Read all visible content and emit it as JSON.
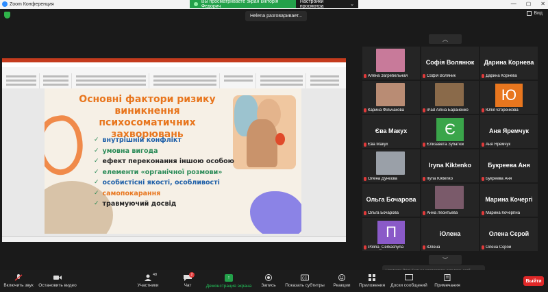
{
  "window": {
    "title": "Zoom Конференция",
    "controls": [
      "—",
      "▢",
      "✕"
    ]
  },
  "share_banner": {
    "text": "Вы просматриваете экран Вікторія Федорич",
    "options_label": "Настройки просмотра"
  },
  "view_button": {
    "label": "Вид"
  },
  "speaking_indicator": {
    "text": "Helena разговаривает..."
  },
  "slide": {
    "title": "Основні фактори ризику виникнення психосоматичних захворювань",
    "bullets": [
      {
        "text": "внутрішній конфлікт",
        "color": "#1e5fa8"
      },
      {
        "text": "умовна вигода",
        "color": "#2a8a57"
      },
      {
        "text": "ефект переконання іншою особою",
        "color": "#222222"
      },
      {
        "text": "елементи «органічної розмови»",
        "color": "#2a8a57"
      },
      {
        "text": "особистісні якості, особливості",
        "color": "#1e5fa8"
      },
      {
        "text": "самопокарання",
        "color": "#e8761e"
      },
      {
        "text": "травмуючий досвід",
        "color": "#222222"
      }
    ]
  },
  "participants": [
    {
      "name": "Алёна Загребельная",
      "type": "photo",
      "color": "#c87a9a"
    },
    {
      "name": "Софія Воляник",
      "big": "Софія Волянюк",
      "type": "name"
    },
    {
      "name": "Дарина Корнева",
      "big": "Дарина Корнева",
      "type": "name"
    },
    {
      "name": "Карина Фільчакова",
      "type": "photo",
      "color": "#b98c74"
    },
    {
      "name": "iPad Аліна Бараненко",
      "type": "photo",
      "color": "#8a6a4a"
    },
    {
      "name": "Юлія Єгоренкова",
      "type": "avatar",
      "letter": "Ю",
      "color": "#e8761e"
    },
    {
      "name": "Єва Макух",
      "big": "Єва Макух",
      "type": "name"
    },
    {
      "name": "Єлизавета Зубатюк",
      "type": "avatar",
      "letter": "Є",
      "color": "#3aa54a"
    },
    {
      "name": "Аня Яремчук",
      "big": "Аня Яремчук",
      "type": "name"
    },
    {
      "name": "Олена Дунєєва",
      "type": "photo",
      "color": "#9aa0a8"
    },
    {
      "name": "Iryna Kiktenko",
      "big": "Iryna Kiktenko",
      "type": "name"
    },
    {
      "name": "Букреева Аня",
      "big": "Букреева Аня",
      "type": "name"
    },
    {
      "name": "Ольга Бочарова",
      "big": "Ольга Бочарова",
      "type": "name"
    },
    {
      "name": "Анна Леонтьева",
      "type": "photo",
      "color": "#7a5a6a"
    },
    {
      "name": "Марина Кочергіна",
      "big": "Марина Кочергі",
      "type": "name"
    },
    {
      "name": "Polina_Cerkashyna",
      "type": "avatar",
      "letter": "П",
      "color": "#8a5ac8"
    },
    {
      "name": "іОлена",
      "big": "іОлена",
      "type": "name"
    },
    {
      "name": "Олена Сєрой",
      "big": "Олена Сєрой",
      "type": "name"
    }
  ],
  "toolbar": {
    "mute": "Включить звук",
    "video": "Остановить видео",
    "participants": "Участники",
    "participants_count": "48",
    "chat": "Чат",
    "chat_badge": "2",
    "share": "Демонстрация экрана",
    "record": "Запись",
    "captions": "Показать субтитры",
    "reactions": "Реакции",
    "apps": "Приложения",
    "whiteboards": "Доски сообщений",
    "notes": "Примечания",
    "leave": "Выйти"
  },
  "tooltip": {
    "text": "Нажмите Print Scrn на клавиатуре для того, щоб зробити скріншот"
  }
}
